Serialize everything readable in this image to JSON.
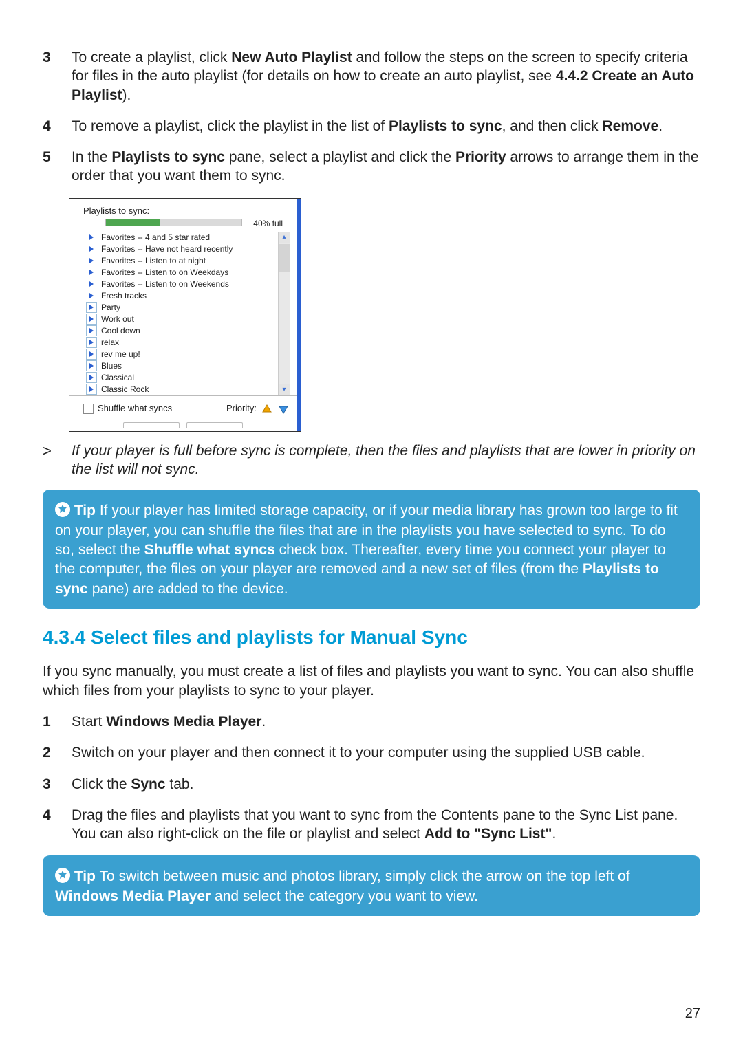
{
  "list1": [
    {
      "num": "3",
      "parts": [
        {
          "t": "To create a playlist, click "
        },
        {
          "t": "New Auto Playlist",
          "b": true
        },
        {
          "t": " and follow the steps on the screen to specify criteria for files in the auto playlist (for details on how to create an auto playlist, see "
        },
        {
          "t": "4.4.2 Create an Auto Playlist",
          "b": true
        },
        {
          "t": ")."
        }
      ]
    },
    {
      "num": "4",
      "parts": [
        {
          "t": "To remove a playlist, click the playlist in the list of "
        },
        {
          "t": "Playlists to sync",
          "b": true
        },
        {
          "t": ", and then click "
        },
        {
          "t": "Remove",
          "b": true
        },
        {
          "t": "."
        }
      ]
    },
    {
      "num": "5",
      "parts": [
        {
          "t": "In the "
        },
        {
          "t": "Playlists to sync",
          "b": true
        },
        {
          "t": " pane, select a playlist and click the "
        },
        {
          "t": "Priority",
          "b": true
        },
        {
          "t": " arrows to arrange them in the order that you want them to sync."
        }
      ]
    }
  ],
  "figure": {
    "title": "Playlists to sync:",
    "percent": "40% full",
    "items": [
      {
        "label": "Favorites -- 4 and 5 star rated",
        "boxed": false
      },
      {
        "label": "Favorites -- Have not heard recently",
        "boxed": false
      },
      {
        "label": "Favorites -- Listen to at night",
        "boxed": false
      },
      {
        "label": "Favorites -- Listen to on Weekdays",
        "boxed": false
      },
      {
        "label": "Favorites -- Listen to on Weekends",
        "boxed": false
      },
      {
        "label": "Fresh tracks",
        "boxed": false
      },
      {
        "label": "Party",
        "boxed": true
      },
      {
        "label": "Work out",
        "boxed": true
      },
      {
        "label": "Cool down",
        "boxed": true
      },
      {
        "label": "relax",
        "boxed": true
      },
      {
        "label": "rev me up!",
        "boxed": true
      },
      {
        "label": "Blues",
        "boxed": true
      },
      {
        "label": "Classical",
        "boxed": true
      },
      {
        "label": "Classic Rock",
        "boxed": true
      }
    ],
    "shuffle": "Shuffle what syncs",
    "priority": "Priority:"
  },
  "gtnote": "If your player is full before sync is complete, then the files and playlists that are lower in priority on the list will not sync.",
  "gtmark": ">",
  "tip1": {
    "label": "Tip",
    "parts": [
      {
        "t": " If your player has limited storage capacity, or if your media library has grown too large to fit on your player, you can shuffle the files that are in the playlists you have selected to sync. To do so, select the "
      },
      {
        "t": "Shuffle what syncs",
        "b": true
      },
      {
        "t": " check box. Thereafter, every time you connect your player to the computer, the files on your player are removed and a new set of files (from the "
      },
      {
        "t": "Playlists to sync",
        "b": true
      },
      {
        "t": " pane) are added to the device."
      }
    ]
  },
  "section_heading": "4.3.4 Select files and playlists for Manual Sync",
  "section_intro": "If you sync manually, you must create a list of files and playlists you want to sync. You can also shuffle which files from your playlists to sync to your player.",
  "list2": [
    {
      "num": "1",
      "parts": [
        {
          "t": "Start "
        },
        {
          "t": "Windows Media Player",
          "b": true
        },
        {
          "t": "."
        }
      ]
    },
    {
      "num": "2",
      "parts": [
        {
          "t": "Switch on your player and then connect it to your computer using the supplied USB cable."
        }
      ]
    },
    {
      "num": "3",
      "parts": [
        {
          "t": "Click the "
        },
        {
          "t": "Sync",
          "b": true
        },
        {
          "t": " tab."
        }
      ]
    },
    {
      "num": "4",
      "parts": [
        {
          "t": "Drag the files and playlists that you want to sync from the Contents pane to the Sync List pane. You can also right-click on the file or playlist and select "
        },
        {
          "t": "Add to \"Sync List\"",
          "b": true
        },
        {
          "t": "."
        }
      ]
    }
  ],
  "tip2": {
    "label": "Tip",
    "parts": [
      {
        "t": " To switch between music and photos library, simply click the arrow on the top left of "
      },
      {
        "t": "Windows Media Player",
        "b": true
      },
      {
        "t": " and select the category you want to view."
      }
    ]
  },
  "page_number": "27"
}
